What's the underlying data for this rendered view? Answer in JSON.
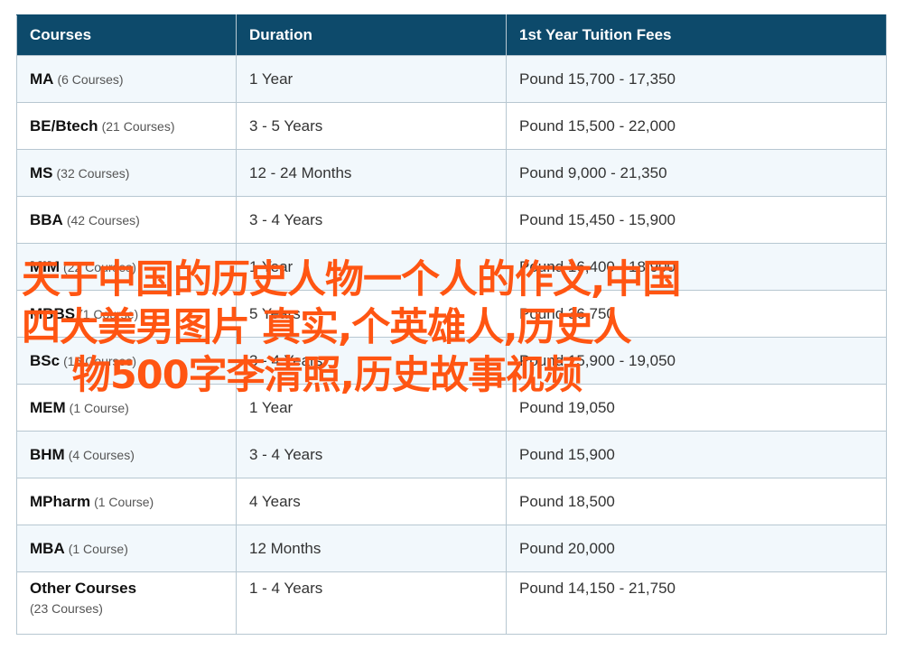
{
  "table": {
    "headers": [
      "Courses",
      "Duration",
      "1st Year Tuition Fees"
    ],
    "rows": [
      {
        "name": "MA",
        "count": "(6 Courses)",
        "duration": "1 Year",
        "fees": "Pound 15,700 - 17,350"
      },
      {
        "name": "BE/Btech",
        "count": "(21 Courses)",
        "duration": "3 - 5 Years",
        "fees": "Pound 15,500 - 22,000"
      },
      {
        "name": "MS",
        "count": "(32 Courses)",
        "duration": "12 - 24 Months",
        "fees": "Pound 9,000 - 21,350"
      },
      {
        "name": "BBA",
        "count": "(42 Courses)",
        "duration": "3 - 4 Years",
        "fees": "Pound 15,450 - 15,900"
      },
      {
        "name": "MIM",
        "count": "(22 Courses)",
        "duration": "1 Year",
        "fees": "Pound 16,400 - 18,900"
      },
      {
        "name": "MBBS",
        "count": "(1 Course)",
        "duration": "5 Years",
        "fees": "Pound 36,750"
      },
      {
        "name": "BSc",
        "count": "(16 Courses)",
        "duration": "3 - 4 Years",
        "fees": "Pound 15,900 - 19,050"
      },
      {
        "name": "MEM",
        "count": "(1 Course)",
        "duration": "1 Year",
        "fees": "Pound 19,050"
      },
      {
        "name": "BHM",
        "count": "(4 Courses)",
        "duration": "3 - 4 Years",
        "fees": "Pound 15,900"
      },
      {
        "name": "MPharm",
        "count": "(1 Course)",
        "duration": "4 Years",
        "fees": "Pound 18,500"
      },
      {
        "name": "MBA",
        "count": "(1 Course)",
        "duration": "12 Months",
        "fees": "Pound 20,000"
      },
      {
        "name": "Other Courses",
        "count": "(23 Courses)",
        "duration": "1 - 4 Years",
        "fees": "Pound 14,150 - 21,750"
      }
    ]
  },
  "overlay": {
    "text": "天于中国的历史人物一个人的作文,中国\n四大美男图片 真实,个英雄人,历史人\n    物500字李清照,历史故事视频"
  },
  "colors": {
    "header_bg": "#0d4a6b",
    "alt_row_bg": "#f2f8fc",
    "overlay_text": "#ff5512"
  }
}
